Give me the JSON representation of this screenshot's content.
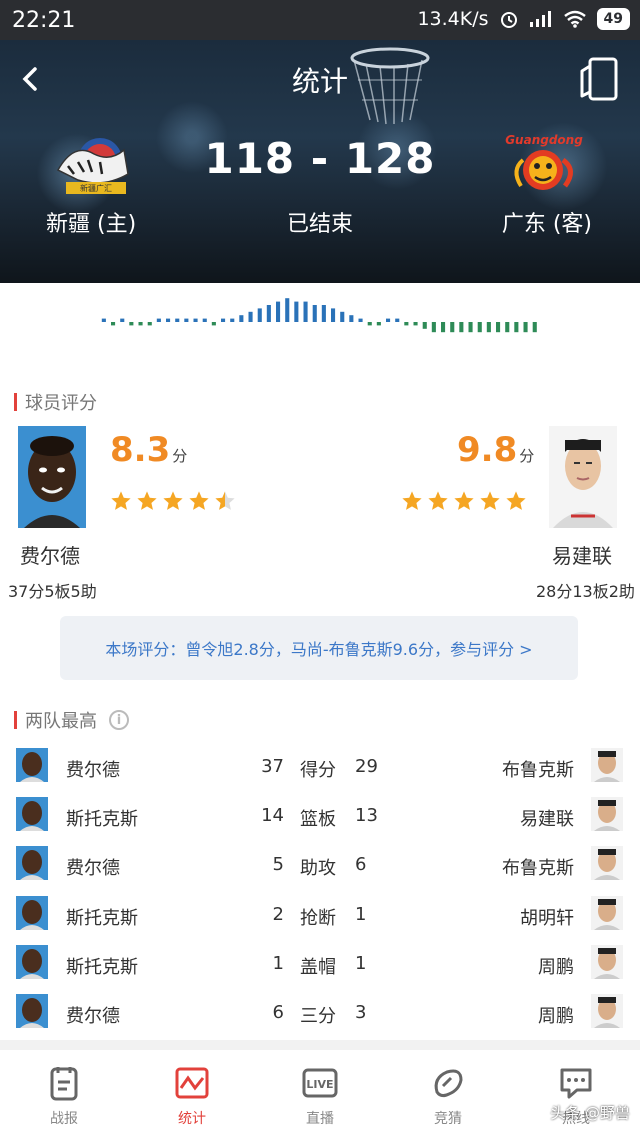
{
  "status_bar": {
    "time": "22:21",
    "speed": "13.4K/s",
    "battery": "49"
  },
  "header": {
    "title": "统计",
    "score": "118 - 128",
    "state": "已结束",
    "home_team": "新疆 (主)",
    "away_team": "广东 (客)",
    "home_logo_text": "新疆广汇",
    "away_logo_text": "Guangdong"
  },
  "ratings": {
    "section_title": "球员评分",
    "unit": "分",
    "left": {
      "score": "8.3",
      "stars": 4.5,
      "name": "费尔德",
      "stats": "37分5板5助"
    },
    "right": {
      "score": "9.8",
      "stars": 5,
      "name": "易建联",
      "stats": "28分13板2助"
    },
    "summary": "本场评分：曾令旭2.8分，马尚-布鲁克斯9.6分，参与评分 >"
  },
  "leaders": {
    "section_title": "两队最高",
    "rows": [
      {
        "home_player": "费尔德",
        "home_value": "37",
        "category": "得分",
        "away_value": "29",
        "away_player": "布鲁克斯"
      },
      {
        "home_player": "斯托克斯",
        "home_value": "14",
        "category": "篮板",
        "away_value": "13",
        "away_player": "易建联"
      },
      {
        "home_player": "费尔德",
        "home_value": "5",
        "category": "助攻",
        "away_value": "6",
        "away_player": "布鲁克斯"
      },
      {
        "home_player": "斯托克斯",
        "home_value": "2",
        "category": "抢断",
        "away_value": "1",
        "away_player": "胡明轩"
      },
      {
        "home_player": "斯托克斯",
        "home_value": "1",
        "category": "盖帽",
        "away_value": "1",
        "away_player": "周鹏"
      },
      {
        "home_player": "费尔德",
        "home_value": "6",
        "category": "三分",
        "away_value": "3",
        "away_player": "周鹏"
      }
    ]
  },
  "tabs": [
    {
      "label": "战报",
      "icon": "report-icon"
    },
    {
      "label": "统计",
      "icon": "stats-icon",
      "active": true
    },
    {
      "label": "直播",
      "icon": "live-icon"
    },
    {
      "label": "竞猜",
      "icon": "guess-icon"
    },
    {
      "label": "热线",
      "icon": "hotline-icon"
    }
  ],
  "watermark": "头条 @野兽",
  "colors": {
    "accent": "#e2413b",
    "rating": "#f08a24",
    "star": "#f5a623",
    "link": "#3c78c8",
    "home_bar": "#2a72b8",
    "away_bar": "#2e8b57"
  },
  "momentum": [
    1,
    -1,
    1,
    -1,
    -1,
    -1,
    1,
    1,
    1,
    1,
    1,
    1,
    -1,
    1,
    1,
    2,
    3,
    4,
    5,
    6,
    7,
    6,
    6,
    5,
    5,
    4,
    3,
    2,
    1,
    -1,
    -1,
    1,
    1,
    -1,
    -1,
    -2,
    -3,
    -3,
    -3,
    -3,
    -3,
    -3,
    -3,
    -3,
    -3,
    -3,
    -3,
    -3
  ]
}
